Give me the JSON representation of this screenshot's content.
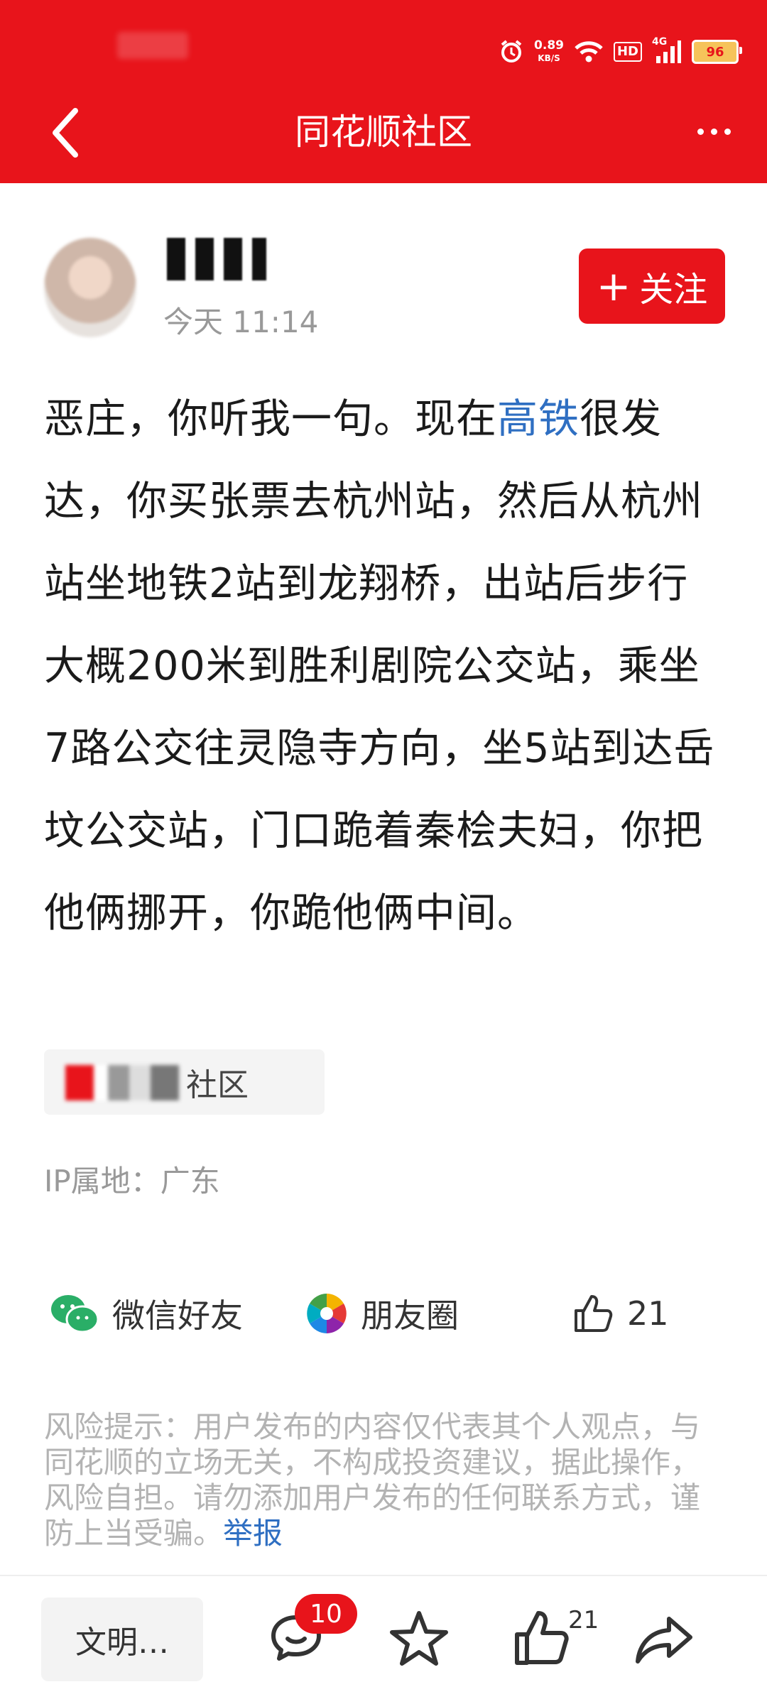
{
  "header": {
    "title": "同花顺社区",
    "net_speed": [
      "0.89",
      "KB/S"
    ],
    "hd": "HD",
    "signal": "4G",
    "battery": "96"
  },
  "post": {
    "time": "今天 11:14",
    "follow_label": "关注",
    "content_before": "恶庄，你听我一句。现在",
    "content_highlight": "高铁",
    "content_after": "很发达，你买张票去杭州站，然后从杭州站坐地铁2站到龙翔桥，出站后步行大概200米到胜利剧院公交站，乘坐7路公交往灵隐寺方向，坐5站到达岳坟公交站，门口跪着秦桧夫妇，你把他俩挪开，你跪他俩中间。",
    "community": "社区",
    "ip_location": "IP属地：广东"
  },
  "share": {
    "wechat": "微信好友",
    "moments": "朋友圈",
    "likes": "21"
  },
  "disclaimer": {
    "text": "风险提示：用户发布的内容仅代表其个人观点，与同花顺的立场无关，不构成投资建议，据此操作，风险自担。请勿添加用户发布的任何联系方式，谨防上当受骗。",
    "report": "举报"
  },
  "bottom_bar": {
    "comment_placeholder": "文明…",
    "comment_count": "10",
    "like_count": "21"
  },
  "colors": {
    "brand_red": "#e8141b",
    "link_blue": "#2f6fc2"
  }
}
